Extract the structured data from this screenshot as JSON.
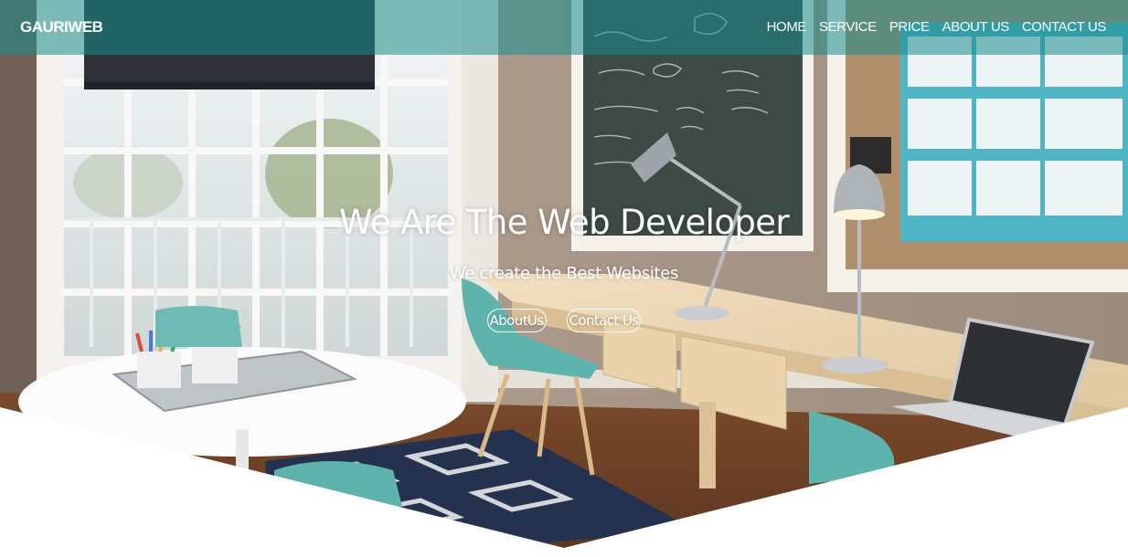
{
  "brand": {
    "name": "GAURIWEB"
  },
  "nav": {
    "items": [
      {
        "label": "HOME"
      },
      {
        "label": "SERVICE"
      },
      {
        "label": "PRICE"
      },
      {
        "label": "ABOUT US"
      },
      {
        "label": "CONTACT US"
      }
    ]
  },
  "hero": {
    "title": "We Are The Web Developer",
    "subtitle": "We create the Best Websites",
    "buttons": {
      "about": "AboutUs",
      "contact": "Contact Us"
    },
    "background": "office-interior-photo"
  },
  "colors": {
    "navbar_overlay": "#1a8c8c",
    "text": "#ffffff",
    "page_background": "#ffffff"
  }
}
